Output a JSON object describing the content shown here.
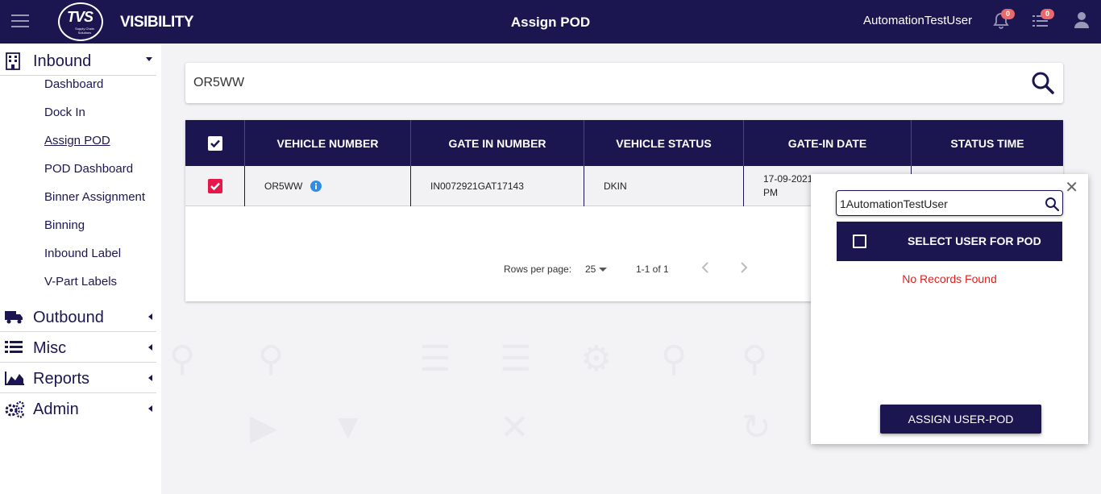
{
  "header": {
    "logo_text": "TVS",
    "logo_subtext": "Supply Chain Solutions",
    "app_title": "VISIBILITY",
    "page_title": "Assign POD",
    "username": "AutomationTestUser",
    "notifications_count": "0",
    "tasks_count": "0"
  },
  "sidebar": {
    "inbound": {
      "label": "Inbound",
      "items": [
        "Dashboard",
        "Dock In",
        "Assign POD",
        "POD Dashboard",
        "Binner Assignment",
        "Binning",
        "Inbound Label",
        "V-Part Labels"
      ],
      "active": "Assign POD"
    },
    "outbound": {
      "label": "Outbound"
    },
    "misc": {
      "label": "Misc"
    },
    "reports": {
      "label": "Reports"
    },
    "admin": {
      "label": "Admin"
    }
  },
  "search": {
    "value": "OR5WW"
  },
  "table": {
    "headers": {
      "vehicle_number": "VEHICLE NUMBER",
      "gate_in_number": "GATE IN NUMBER",
      "vehicle_status": "VEHICLE STATUS",
      "gate_in_date": "GATE-IN DATE",
      "status_time": "STATUS TIME"
    },
    "rows": [
      {
        "vehicle_number": "OR5WW",
        "gate_in_number": "IN0072921GAT17143",
        "vehicle_status": "DKIN",
        "gate_in_date": "17-09-2021",
        "gate_in_date_2": "PM",
        "checked": true
      }
    ],
    "pagination": {
      "rows_per_page_label": "Rows per page:",
      "rows_per_page": "25",
      "range": "1-1 of 1"
    }
  },
  "popup": {
    "search_value": "1AutomationTestUser",
    "header_label": "SELECT USER FOR POD",
    "empty_message": "No Records Found",
    "assign_label": "ASSIGN USER-POD"
  },
  "colors": {
    "primary": "#1b1650",
    "checkbox_checked": "#e8174b",
    "error_text": "#e02020",
    "badge": "#e86a6a"
  }
}
